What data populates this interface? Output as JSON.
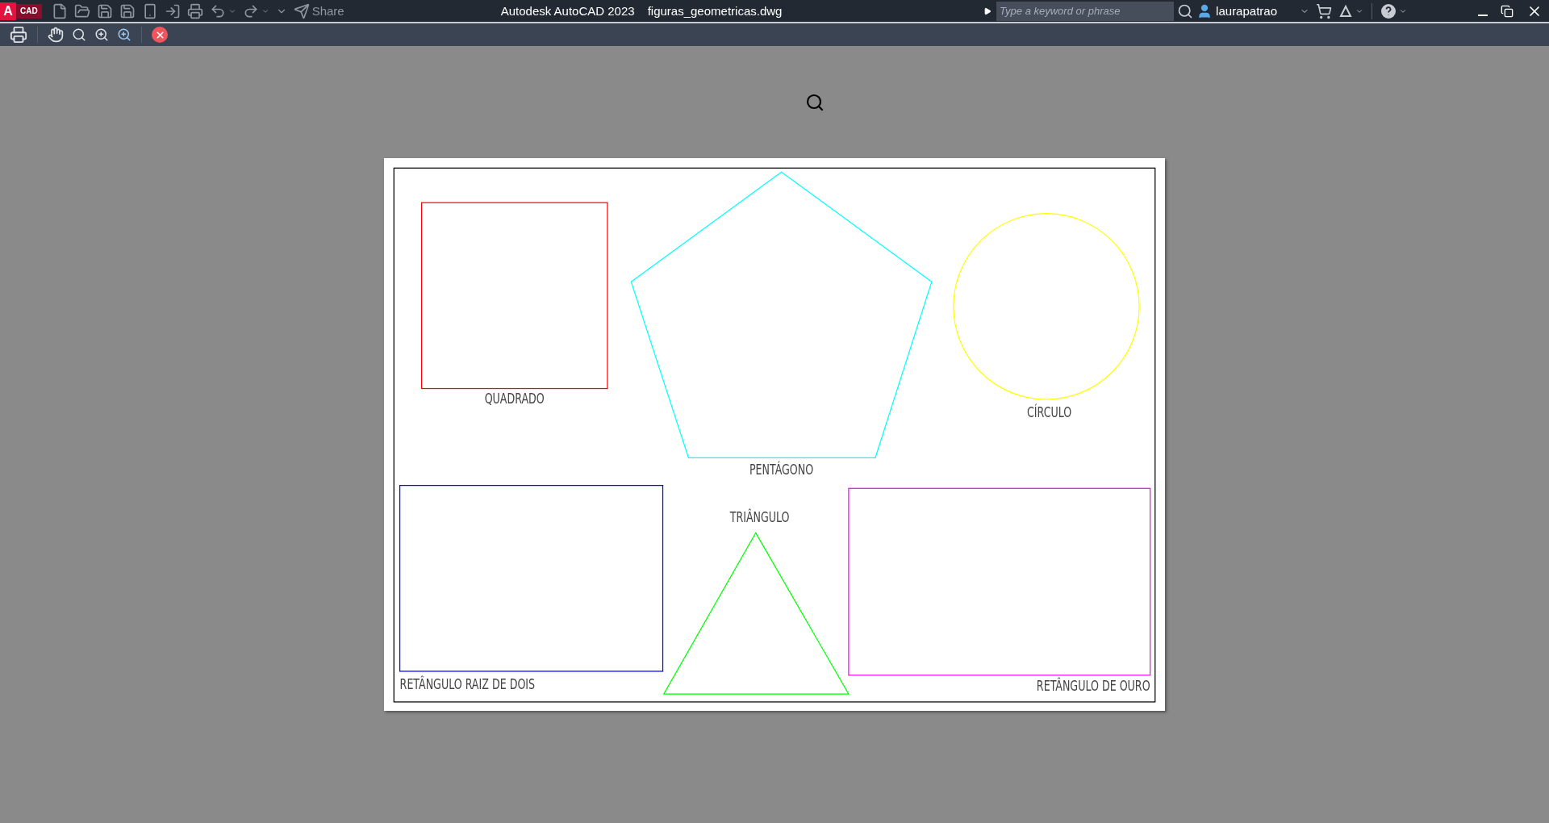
{
  "title_bar": {
    "logo_letter": "A",
    "app_badge": "CAD",
    "share_label": "Share",
    "app_title": "Autodesk AutoCAD 2023",
    "file_name": "figuras_geometricas.dwg",
    "search": {
      "placeholder": "Type a keyword or phrase"
    },
    "user_name": "laurapatrao"
  },
  "drawing": {
    "shapes": [
      {
        "kind": "square",
        "color": "#ff0000",
        "label": "QUADRADO"
      },
      {
        "kind": "pentagon",
        "color": "#00ffff",
        "label": "PENTÁGONO"
      },
      {
        "kind": "circle",
        "color": "#ffff00",
        "label": "CÍRCULO"
      },
      {
        "kind": "rectangle",
        "color": "#0000ff",
        "label": "RETÂNGULO RAIZ DE DOIS"
      },
      {
        "kind": "triangle",
        "color": "#00ff00",
        "label": "TRIÂNGULO"
      },
      {
        "kind": "rectangle",
        "color": "#ff00ff",
        "label": "RETÂNGULO DE OURO"
      }
    ]
  }
}
